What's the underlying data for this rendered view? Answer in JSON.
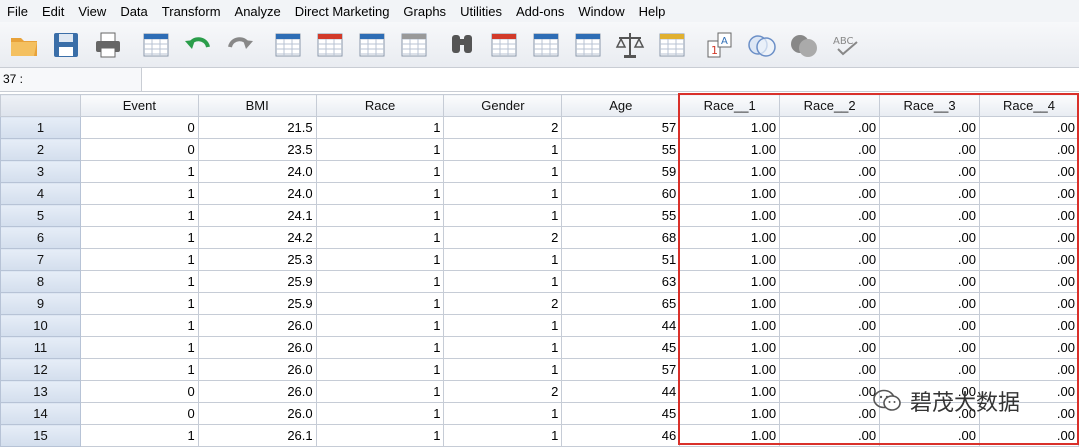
{
  "menu": [
    "File",
    "Edit",
    "View",
    "Data",
    "Transform",
    "Analyze",
    "Direct Marketing",
    "Graphs",
    "Utilities",
    "Add-ons",
    "Window",
    "Help"
  ],
  "toolbar": [
    {
      "name": "open-folder-icon",
      "color": "#e8a23a"
    },
    {
      "name": "save-icon",
      "color": "#3a6ea8"
    },
    {
      "name": "print-icon",
      "color": "#666666"
    },
    {
      "name": "dialog-recall-icon",
      "color": "#2e6db5"
    },
    {
      "name": "undo-icon",
      "color": "#2a9d4a"
    },
    {
      "name": "redo-icon",
      "color": "#888888"
    },
    {
      "name": "goto-case-icon",
      "color": "#2e6db5"
    },
    {
      "name": "goto-variable-icon",
      "color": "#d23a2a"
    },
    {
      "name": "variables-icon",
      "color": "#2e6db5"
    },
    {
      "name": "run-descriptives-icon",
      "color": "#999999"
    },
    {
      "name": "find-icon",
      "color": "#555555"
    },
    {
      "name": "insert-cases-icon",
      "color": "#d23a2a"
    },
    {
      "name": "insert-variable-icon",
      "color": "#2e6db5"
    },
    {
      "name": "split-file-icon",
      "color": "#2e6db5"
    },
    {
      "name": "weight-cases-icon",
      "color": "#555555"
    },
    {
      "name": "select-cases-icon",
      "color": "#e0b030"
    },
    {
      "name": "value-labels-icon",
      "color": "#d23a2a"
    },
    {
      "name": "use-sets-icon",
      "color": "#6b8fc7"
    },
    {
      "name": "show-all-variables-icon",
      "color": "#888888"
    },
    {
      "name": "spell-check-icon",
      "color": "#888888"
    }
  ],
  "refbar": {
    "cell": "37 :",
    "value": ""
  },
  "columns": [
    "Event",
    "BMI",
    "Race",
    "Gender",
    "Age",
    "Race__1",
    "Race__2",
    "Race__3",
    "Race__4"
  ],
  "rows": [
    {
      "n": "1",
      "cells": [
        "0",
        "21.5",
        "1",
        "2",
        "57",
        "1.00",
        ".00",
        ".00",
        ".00"
      ]
    },
    {
      "n": "2",
      "cells": [
        "0",
        "23.5",
        "1",
        "1",
        "55",
        "1.00",
        ".00",
        ".00",
        ".00"
      ]
    },
    {
      "n": "3",
      "cells": [
        "1",
        "24.0",
        "1",
        "1",
        "59",
        "1.00",
        ".00",
        ".00",
        ".00"
      ]
    },
    {
      "n": "4",
      "cells": [
        "1",
        "24.0",
        "1",
        "1",
        "60",
        "1.00",
        ".00",
        ".00",
        ".00"
      ]
    },
    {
      "n": "5",
      "cells": [
        "1",
        "24.1",
        "1",
        "1",
        "55",
        "1.00",
        ".00",
        ".00",
        ".00"
      ]
    },
    {
      "n": "6",
      "cells": [
        "1",
        "24.2",
        "1",
        "2",
        "68",
        "1.00",
        ".00",
        ".00",
        ".00"
      ]
    },
    {
      "n": "7",
      "cells": [
        "1",
        "25.3",
        "1",
        "1",
        "51",
        "1.00",
        ".00",
        ".00",
        ".00"
      ]
    },
    {
      "n": "8",
      "cells": [
        "1",
        "25.9",
        "1",
        "1",
        "63",
        "1.00",
        ".00",
        ".00",
        ".00"
      ]
    },
    {
      "n": "9",
      "cells": [
        "1",
        "25.9",
        "1",
        "2",
        "65",
        "1.00",
        ".00",
        ".00",
        ".00"
      ]
    },
    {
      "n": "10",
      "cells": [
        "1",
        "26.0",
        "1",
        "1",
        "44",
        "1.00",
        ".00",
        ".00",
        ".00"
      ]
    },
    {
      "n": "11",
      "cells": [
        "1",
        "26.0",
        "1",
        "1",
        "45",
        "1.00",
        ".00",
        ".00",
        ".00"
      ]
    },
    {
      "n": "12",
      "cells": [
        "1",
        "26.0",
        "1",
        "1",
        "57",
        "1.00",
        ".00",
        ".00",
        ".00"
      ]
    },
    {
      "n": "13",
      "cells": [
        "0",
        "26.0",
        "1",
        "2",
        "44",
        "1.00",
        ".00",
        ".00",
        ".00"
      ]
    },
    {
      "n": "14",
      "cells": [
        "0",
        "26.0",
        "1",
        "1",
        "45",
        "1.00",
        ".00",
        ".00",
        ".00"
      ]
    },
    {
      "n": "15",
      "cells": [
        "1",
        "26.1",
        "1",
        "1",
        "46",
        "1.00",
        ".00",
        ".00",
        ".00"
      ]
    }
  ],
  "highlight_color": "#d9302a",
  "watermark": "碧茂大数据"
}
